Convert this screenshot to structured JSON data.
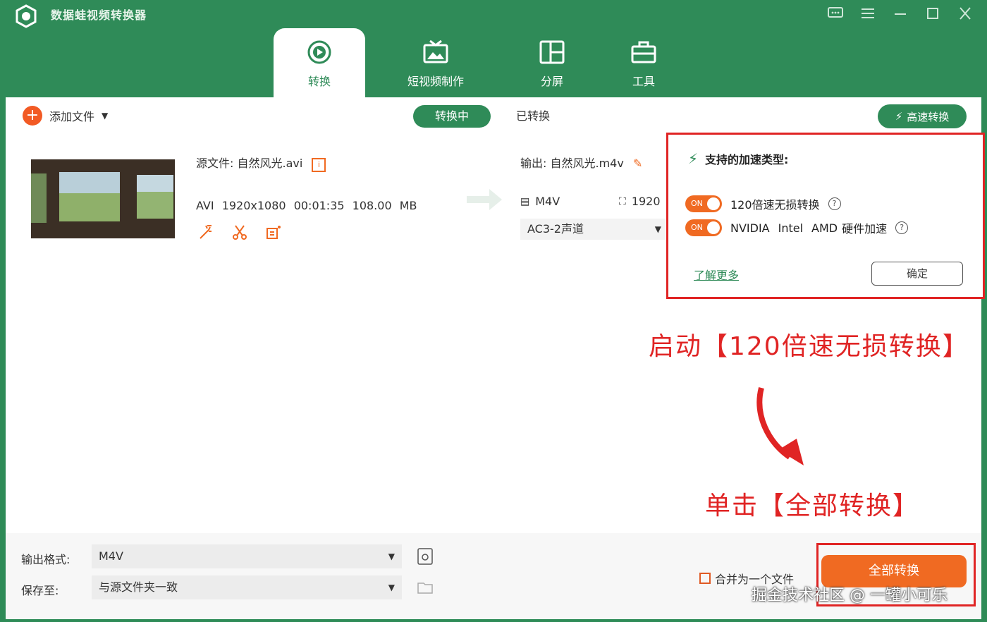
{
  "app": {
    "title": "数据蛙视频转换器"
  },
  "tabs": [
    {
      "label": "转换",
      "icon": "convert-icon"
    },
    {
      "label": "短视频制作",
      "icon": "tv-icon"
    },
    {
      "label": "分屏",
      "icon": "split-screen-icon"
    },
    {
      "label": "工具",
      "icon": "toolbox-icon"
    }
  ],
  "toolbar": {
    "add_file": "添加文件",
    "converting": "转换中",
    "converted": "已转换",
    "speed_convert": "高速转换"
  },
  "file": {
    "source_label": "源文件:  自然风光.avi",
    "format": "AVI",
    "resolution": "1920x1080",
    "duration": "00:01:35",
    "size": "108.00 MB",
    "output_label": "输出:  自然风光.m4v",
    "output_format": "M4V",
    "output_res": "1920",
    "audio": "AC3-2声道"
  },
  "popup": {
    "title": "支持的加速类型:",
    "option1": "120倍速无损转换",
    "option2_nvidia": "NVIDIA",
    "option2_intel": "Intel",
    "option2_amd": "AMD",
    "option2_suffix": "硬件加速",
    "toggle_on": "ON",
    "learn_more": "了解更多",
    "ok": "确定"
  },
  "annotations": {
    "enable": "启动【120倍速无损转换】",
    "click": "单击【全部转换】"
  },
  "bottom": {
    "output_format_label": "输出格式:",
    "output_format_value": "M4V",
    "save_to_label": "保存至:",
    "save_to_value": "与源文件夹一致",
    "merge": "合并为一个文件",
    "convert_all": "全部转换"
  },
  "watermark": "掘金技术社区 @ 一罐小可乐",
  "colors": {
    "brand_green": "#2f8b58",
    "accent_orange": "#f06a22",
    "annotation_red": "#e02424"
  }
}
